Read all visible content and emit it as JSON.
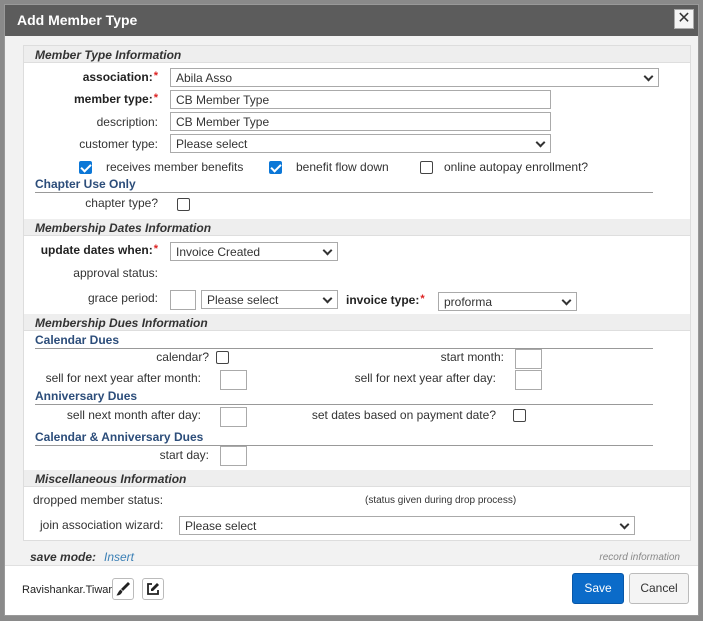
{
  "dialog": {
    "title": "Add Member Type",
    "close_symbol": "✕"
  },
  "sections": {
    "member_type_info": "Member Type Information",
    "chapter_use_only": "Chapter Use Only",
    "membership_dates": "Membership Dates Information",
    "membership_dues": "Membership Dues Information",
    "calendar_dues": "Calendar Dues",
    "anniversary_dues": "Anniversary Dues",
    "calendar_anniversary_dues": "Calendar & Anniversary Dues",
    "misc_info": "Miscellaneous Information"
  },
  "fields": {
    "association_label": "association:",
    "association_value": "Abila Asso",
    "member_type_label": "member type:",
    "member_type_value": "CB Member Type",
    "description_label": "description:",
    "description_value": "CB Member Type",
    "customer_type_label": "customer type:",
    "customer_type_value": "Please select",
    "receives_benefits_label": "receives member benefits",
    "receives_benefits_checked": true,
    "benefit_flow_down_label": "benefit flow down",
    "benefit_flow_down_checked": true,
    "online_autopay_label": "online autopay enrollment?",
    "online_autopay_checked": false,
    "chapter_type_label": "chapter type?",
    "chapter_type_checked": false,
    "update_dates_label": "update dates when:",
    "update_dates_value": "Invoice Created",
    "approval_status_label": "approval status:",
    "grace_period_label": "grace period:",
    "grace_period_value": "",
    "grace_period_unit": "Please select",
    "invoice_type_label": "invoice type:",
    "invoice_type_value": "proforma",
    "calendar_label": "calendar?",
    "start_month_label": "start month:",
    "sell_next_after_month_label": "sell for next year after month:",
    "sell_next_after_day_label": "sell for next year after day:",
    "sell_next_month_after_day_label": "sell next month after day:",
    "set_dates_payment_label": "set dates based on payment date?",
    "start_day_label": "start day:",
    "dropped_status_label": "dropped member status:",
    "dropped_status_note": "(status given during drop process)",
    "join_wizard_label": "join association wizard:",
    "join_wizard_value": "Please select"
  },
  "footer": {
    "save_mode_label": "save mode:",
    "save_mode_value": "Insert",
    "record_information": "record information",
    "user_name": "Ravishankar.Tiwari",
    "save_label": "Save",
    "cancel_label": "Cancel"
  },
  "colors": {
    "titlebar": "#5c5c5c",
    "primary_button": "#0b6bc9",
    "checkbox_checked": "#0b77d7",
    "subsection_heading": "#2c4d7a",
    "required_marker": "#dd2222"
  },
  "icons": [
    "close-icon",
    "chevron-down-icon",
    "brush-icon",
    "edit-icon"
  ]
}
